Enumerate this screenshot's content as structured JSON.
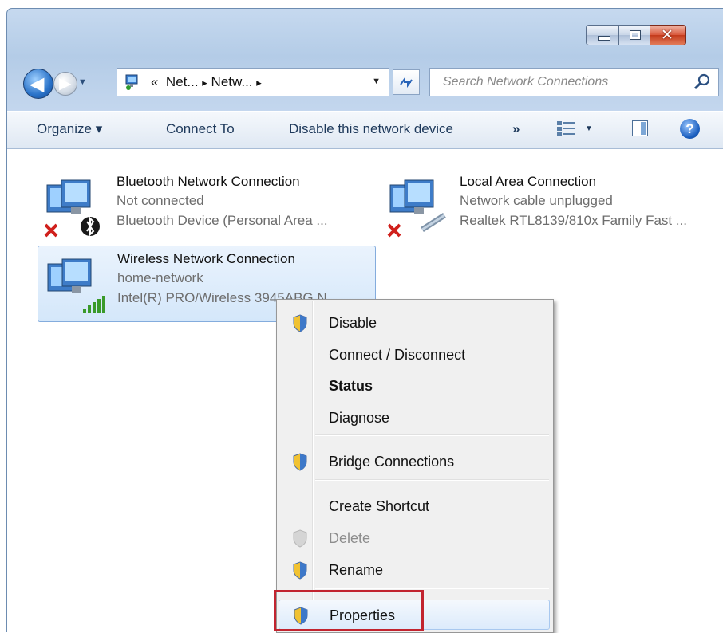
{
  "window": {
    "address": {
      "prefix": "«",
      "crumbs": [
        "Net...",
        "Netw..."
      ],
      "sep": "▸"
    },
    "search_placeholder": "Search Network Connections"
  },
  "toolbar": {
    "organize": "Organize ▾",
    "connect_to": "Connect To",
    "disable_device": "Disable this network device",
    "more": "»",
    "help": "?"
  },
  "connections": [
    {
      "name": "Bluetooth Network Connection",
      "status": "Not connected",
      "device": "Bluetooth Device (Personal Area ..."
    },
    {
      "name": "Local Area Connection",
      "status": "Network cable unplugged",
      "device": "Realtek RTL8139/810x Family Fast ..."
    },
    {
      "name": "Wireless Network Connection",
      "status": "home-network",
      "device": "Intel(R) PRO/Wireless 3945ABG N..."
    }
  ],
  "context_menu": {
    "items": [
      {
        "label": "Disable",
        "shield": true,
        "state": "normal"
      },
      {
        "label": "Connect / Disconnect",
        "shield": false,
        "state": "normal"
      },
      {
        "label": "Status",
        "shield": false,
        "state": "bold"
      },
      {
        "label": "Diagnose",
        "shield": false,
        "state": "normal"
      },
      {
        "label": "Bridge Connections",
        "shield": true,
        "state": "normal"
      },
      {
        "label": "Create Shortcut",
        "shield": false,
        "state": "normal"
      },
      {
        "label": "Delete",
        "shield": true,
        "state": "disabled"
      },
      {
        "label": "Rename",
        "shield": true,
        "state": "normal"
      },
      {
        "label": "Properties",
        "shield": true,
        "state": "highlighted"
      }
    ]
  },
  "colors": {
    "highlight_box": "#c2242f",
    "error_x": "#d0201c",
    "signal": "#3a9a2a"
  }
}
